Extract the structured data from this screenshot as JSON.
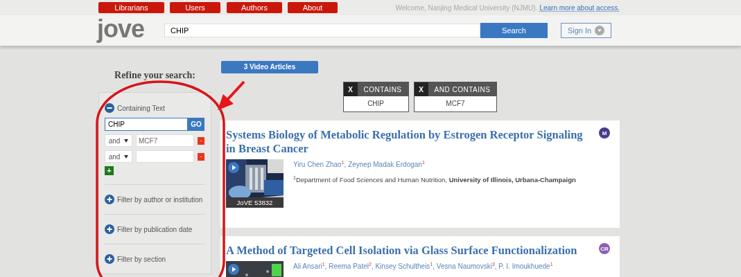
{
  "nav": {
    "tabs": [
      {
        "label": "Librarians"
      },
      {
        "label": "Users"
      },
      {
        "label": "Authors"
      },
      {
        "label": "About"
      }
    ],
    "welcome": "Welcome, Nanjing Medical University (NJMU).",
    "access_link": "Learn more about access."
  },
  "header": {
    "logo": "jove",
    "search": {
      "value": "CHIP"
    },
    "search_button": "Search",
    "sign_in": "Sign In"
  },
  "sidebar": {
    "heading": "Refine your search:",
    "sections": [
      {
        "label": "Containing Text",
        "expanded": true,
        "query": "CHIP",
        "go_button": "GO",
        "conditions": [
          {
            "operator": "and",
            "value": "MCF7",
            "remove": "-"
          },
          {
            "operator": "and",
            "remove": "-"
          }
        ],
        "add": "+"
      },
      {
        "label": "Filter by author or institution",
        "expanded": false
      },
      {
        "label": "Filter by publication date",
        "expanded": false
      },
      {
        "label": "Filter by section",
        "expanded": false
      }
    ]
  },
  "results": {
    "count_label": "3 Video Articles",
    "filters": [
      {
        "remove": "X",
        "label": "CONTAINS",
        "value": "CHIP"
      },
      {
        "remove": "X",
        "label": "AND CONTAINS",
        "value": "MCF7"
      }
    ],
    "articles": [
      {
        "title": "Systems Biology of Metabolic Regulation by Estrogen Receptor Signaling in Breast Cancer",
        "badge": {
          "text": "M",
          "color": "#4a3b8e"
        },
        "author_separator": ",",
        "authors": [
          "Yiru Chen Zhao$^{1}$",
          "Zeynep Madak Erdogan$^{1}$"
        ],
        "affiliation": "$^{1}$Department of Food Sciences and Human Nutrition, **University of Illinois, Urbana-Champaign**",
        "thumbnail": {
          "kind": "picture",
          "caption": "JoVE 53832"
        }
      },
      {
        "title": "A Method of Targeted Cell Isolation via Glass Surface Functionalization",
        "badge": {
          "text": "CR",
          "color": "#8b5fb3"
        },
        "author_separator": ",",
        "authors": [
          "Ali Ansari$^{1}$",
          "Reema Patel$^{2}$",
          "Kinsey Schultheis$^{1}$",
          "Vesna Naumovski$^{3}$",
          "P. I. Imoukhuede$^{1}$"
        ]
      }
    ]
  },
  "annotations": [
    {
      "kind": "ellipse"
    },
    {
      "kind": "arrow"
    }
  ]
}
